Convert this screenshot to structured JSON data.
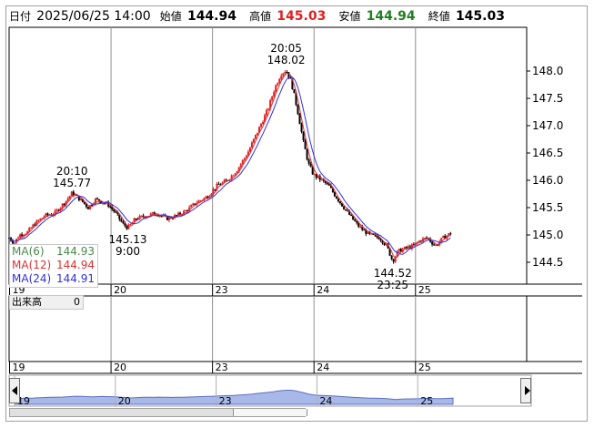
{
  "header": {
    "date_label": "日付",
    "date_value": "2025/06/25 14:00",
    "open_label": "始値",
    "open_value": "144.94",
    "high_label": "高値",
    "high_value": "145.03",
    "low_label": "安値",
    "low_value": "144.94",
    "close_label": "終値",
    "close_value": "145.03",
    "colors": {
      "high": "#e02020",
      "low": "#208020",
      "text": "#000000"
    }
  },
  "legend": [
    {
      "name": "MA(6)",
      "value": "144.93",
      "color": "#4a8a4a"
    },
    {
      "name": "MA(12)",
      "value": "144.94",
      "color": "#e03030"
    },
    {
      "name": "MA(24)",
      "value": "144.91",
      "color": "#3030e0"
    }
  ],
  "volume_panel": {
    "label": "出来高",
    "value": "0"
  },
  "chart_data": {
    "type": "line",
    "title": "",
    "xlabel": "",
    "ylabel": "",
    "x_tick_labels": [
      "19",
      "20",
      "23",
      "24",
      "25"
    ],
    "y_ticks": [
      148.0,
      147.5,
      147.0,
      146.5,
      146.0,
      145.5,
      145.0,
      144.5
    ],
    "y_tick_labels": [
      "148.0",
      "147.5",
      "147.0",
      "146.5",
      "146.0",
      "145.5",
      "145.0",
      "144.5"
    ],
    "ylim": [
      144.1,
      148.8
    ],
    "grid": false,
    "candle_colors": {
      "up": "#e02020",
      "down": "#000000"
    },
    "ma_colors": {
      "ma12": "#e03030",
      "ma24": "#3030e0"
    },
    "price_series": [
      [
        0.0,
        144.95
      ],
      [
        0.05,
        144.85
      ],
      [
        0.1,
        145.0
      ],
      [
        0.18,
        145.05
      ],
      [
        0.25,
        145.2
      ],
      [
        0.35,
        145.35
      ],
      [
        0.45,
        145.4
      ],
      [
        0.55,
        145.6
      ],
      [
        0.62,
        145.77
      ],
      [
        0.7,
        145.65
      ],
      [
        0.78,
        145.5
      ],
      [
        0.85,
        145.65
      ],
      [
        0.92,
        145.6
      ],
      [
        0.98,
        145.55
      ],
      [
        1.05,
        145.4
      ],
      [
        1.12,
        145.2
      ],
      [
        1.17,
        145.13
      ],
      [
        1.25,
        145.3
      ],
      [
        1.35,
        145.35
      ],
      [
        1.45,
        145.4
      ],
      [
        1.55,
        145.3
      ],
      [
        1.65,
        145.35
      ],
      [
        1.75,
        145.45
      ],
      [
        1.85,
        145.6
      ],
      [
        1.95,
        145.7
      ],
      [
        2.05,
        145.9
      ],
      [
        2.15,
        146.0
      ],
      [
        2.25,
        146.2
      ],
      [
        2.35,
        146.5
      ],
      [
        2.45,
        146.9
      ],
      [
        2.55,
        147.3
      ],
      [
        2.62,
        147.7
      ],
      [
        2.68,
        147.95
      ],
      [
        2.73,
        148.02
      ],
      [
        2.78,
        147.8
      ],
      [
        2.84,
        147.3
      ],
      [
        2.9,
        146.7
      ],
      [
        2.95,
        146.3
      ],
      [
        3.0,
        146.1
      ],
      [
        3.08,
        146.0
      ],
      [
        3.15,
        145.9
      ],
      [
        3.22,
        145.7
      ],
      [
        3.3,
        145.5
      ],
      [
        3.38,
        145.3
      ],
      [
        3.45,
        145.15
      ],
      [
        3.55,
        145.0
      ],
      [
        3.65,
        144.95
      ],
      [
        3.72,
        144.8
      ],
      [
        3.78,
        144.52
      ],
      [
        3.83,
        144.7
      ],
      [
        3.9,
        144.75
      ],
      [
        3.98,
        144.8
      ],
      [
        4.05,
        144.9
      ],
      [
        4.12,
        144.95
      ],
      [
        4.2,
        144.8
      ],
      [
        4.28,
        144.95
      ],
      [
        4.35,
        145.03
      ]
    ],
    "annotations": [
      {
        "time": "20:10",
        "value": "145.77",
        "x": 0.62,
        "y": 145.77,
        "position": "above"
      },
      {
        "time": "9:00",
        "value": "145.13",
        "x": 1.17,
        "y": 145.13,
        "position": "below"
      },
      {
        "time": "20:05",
        "value": "148.02",
        "x": 2.73,
        "y": 148.02,
        "position": "above"
      },
      {
        "time": "23:25",
        "value": "144.52",
        "x": 3.78,
        "y": 144.52,
        "position": "below"
      }
    ],
    "x_ticks": [
      0.0,
      1.0,
      2.0,
      3.0,
      4.0
    ],
    "xlim": [
      0.0,
      5.1
    ],
    "overview": {
      "x_tick_labels": [
        "19",
        "20",
        "23",
        "24",
        "25"
      ],
      "fill_color": "#a8b8e8"
    }
  }
}
